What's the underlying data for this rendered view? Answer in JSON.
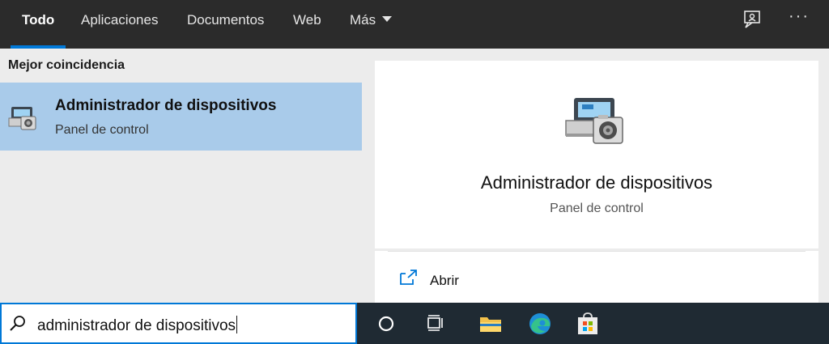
{
  "tabs": [
    {
      "label": "Todo",
      "active": true
    },
    {
      "label": "Aplicaciones",
      "active": false
    },
    {
      "label": "Documentos",
      "active": false
    },
    {
      "label": "Web",
      "active": false
    },
    {
      "label": "Más",
      "active": false
    }
  ],
  "top_icons": {
    "feedback": "feedback-icon",
    "more": "···"
  },
  "left": {
    "section_title": "Mejor coincidencia",
    "best_match": {
      "title": "Administrador de dispositivos",
      "subtitle": "Panel de control",
      "icon": "device-manager-icon"
    }
  },
  "detail": {
    "title": "Administrador de dispositivos",
    "subtitle": "Panel de control",
    "icon": "device-manager-icon",
    "actions": [
      {
        "label": "Abrir",
        "icon": "open-icon"
      }
    ]
  },
  "search": {
    "value": "administrador de dispositivos",
    "icon": "search-icon"
  },
  "taskbar": {
    "items": [
      "cortana-icon",
      "task-view-icon",
      "file-explorer-icon",
      "edge-icon",
      "store-icon"
    ]
  },
  "colors": {
    "accent": "#0078d7",
    "selection": "#a9cbea",
    "topbar": "#2b2b2b",
    "taskbar": "#1f2a33"
  }
}
